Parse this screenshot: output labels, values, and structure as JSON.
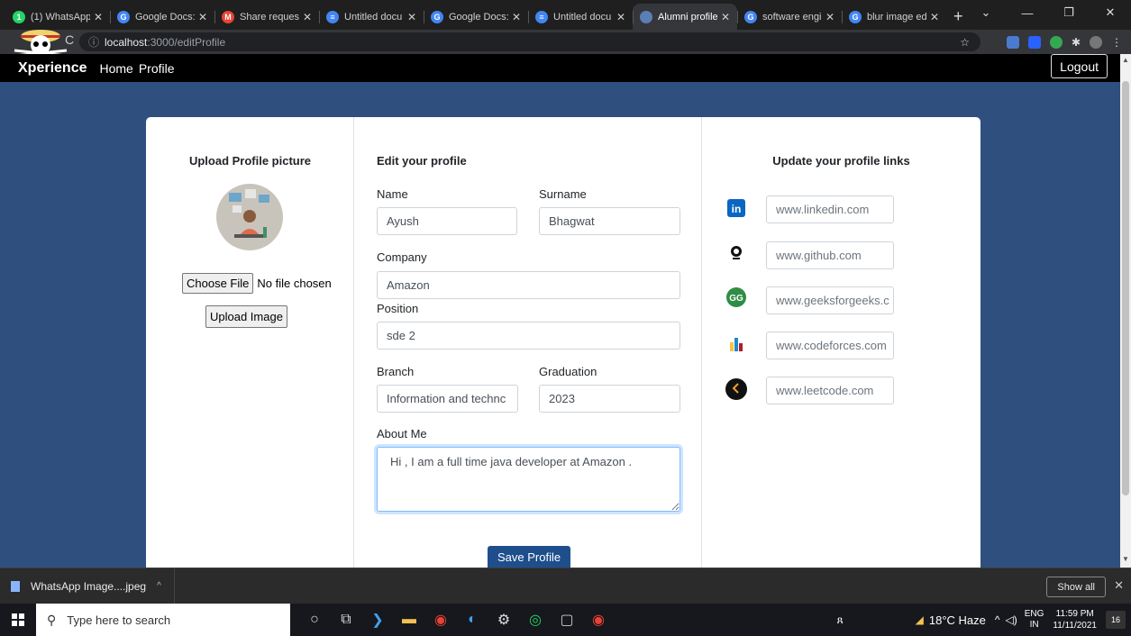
{
  "browser": {
    "tabs": [
      {
        "title": "(1) WhatsApp",
        "color": "#25d366",
        "glyph": "1",
        "active": false
      },
      {
        "title": "Google Docs:",
        "color": "#4285f4",
        "glyph": "G",
        "active": false
      },
      {
        "title": "Share request",
        "color": "#ea4335",
        "glyph": "M",
        "active": false
      },
      {
        "title": "Untitled docu",
        "color": "#4285f4",
        "glyph": "≡",
        "active": false
      },
      {
        "title": "Google Docs:",
        "color": "#4285f4",
        "glyph": "G",
        "active": false
      },
      {
        "title": "Untitled docu",
        "color": "#4285f4",
        "glyph": "≡",
        "active": false
      },
      {
        "title": "Alumni profile",
        "color": "#5b7fb5",
        "glyph": "",
        "active": true
      },
      {
        "title": "software engi",
        "color": "#4285f4",
        "glyph": "G",
        "active": false
      },
      {
        "title": "blur image ed",
        "color": "#4285f4",
        "glyph": "G",
        "active": false
      }
    ],
    "url_host": "localhost",
    "url_path": ":3000/editProfile"
  },
  "navbar": {
    "brand": "Xperience",
    "home": "Home",
    "profile": "Profile",
    "logout": "Logout"
  },
  "upload": {
    "heading": "Upload Profile picture",
    "choose_file": "Choose File",
    "no_file": "No file chosen",
    "upload_btn": "Upload Image"
  },
  "edit": {
    "heading": "Edit your profile",
    "name_label": "Name",
    "name_value": "Ayush",
    "surname_label": "Surname",
    "surname_value": "Bhagwat",
    "company_label": "Company",
    "company_value": "Amazon",
    "position_label": "Position",
    "position_value": "sde 2",
    "branch_label": "Branch",
    "branch_value": "Information and technc",
    "graduation_label": "Graduation",
    "graduation_value": "2023",
    "about_label": "About Me",
    "about_value": "Hi , I am a full time java developer at Amazon .",
    "save": "Save Profile"
  },
  "links": {
    "heading": "Update your profile links",
    "linkedin": "www.linkedin.com",
    "github": "www.github.com",
    "gfg": "www.geeksforgeeks.c",
    "codeforces": "www.codeforces.com",
    "leetcode": "www.leetcode.com"
  },
  "download": {
    "file": "WhatsApp Image....jpeg",
    "show_all": "Show all"
  },
  "taskbar": {
    "search": "Type here to search",
    "weather": "18°C Haze",
    "lang1": "ENG",
    "lang2": "IN",
    "time": "11:59 PM",
    "date": "11/11/2021",
    "notif_count": "16"
  }
}
